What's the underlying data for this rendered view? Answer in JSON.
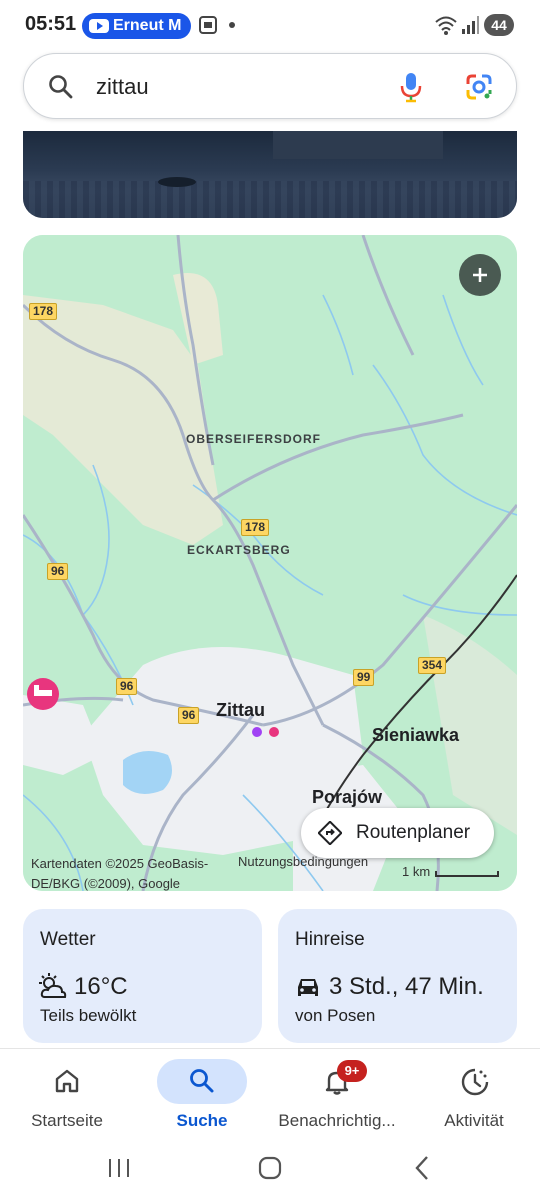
{
  "status_bar": {
    "time": "05:51",
    "media_pill_label": "Erneut M",
    "battery": "44",
    "icons": [
      "youtube-icon",
      "screenshot-icon",
      "wifi-icon",
      "signal-icon",
      "battery-icon"
    ]
  },
  "search": {
    "query": "zittau",
    "icons": [
      "search-icon",
      "microphone-icon",
      "google-lens-icon"
    ]
  },
  "map": {
    "place_labels": {
      "oberseifersdorf": "OBERSEIFERSDORF",
      "eckartsberg": "ECKARTSBERG",
      "zittau": "Zittau",
      "sieniawka": "Sieniawka",
      "porajow": "Porajów"
    },
    "road_shields": {
      "r178a": "178",
      "r178b": "178",
      "r96a": "96",
      "r96b": "96",
      "r96c": "96",
      "r99": "99",
      "r354": "354"
    },
    "route_planner_label": "Routenplaner",
    "attribution": "Kartendaten ©2025 GeoBasis-DE/BKG (©2009), Google",
    "terms": "Nutzungsbedingungen",
    "scale": "1 km",
    "colors": {
      "land": "#bfeccf",
      "water": "#a3d4f5",
      "urban": "#eef0f3",
      "roads": "#aab4c8"
    }
  },
  "weather_card": {
    "title": "Wetter",
    "temperature": "16°C",
    "condition": "Teils bewölkt",
    "icon": "partly-cloudy-icon"
  },
  "travel_card": {
    "title": "Hinreise",
    "duration": "3 Std., 47 Min.",
    "origin": "von Posen",
    "icon": "car-icon"
  },
  "bottom_nav": {
    "items": [
      {
        "label": "Startseite",
        "icon": "home-icon"
      },
      {
        "label": "Suche",
        "icon": "search-icon",
        "active": true
      },
      {
        "label": "Benachrichtig...",
        "icon": "bell-icon",
        "badge": "9+"
      },
      {
        "label": "Aktivität",
        "icon": "activity-icon"
      }
    ],
    "accent": "#0b57d0"
  }
}
